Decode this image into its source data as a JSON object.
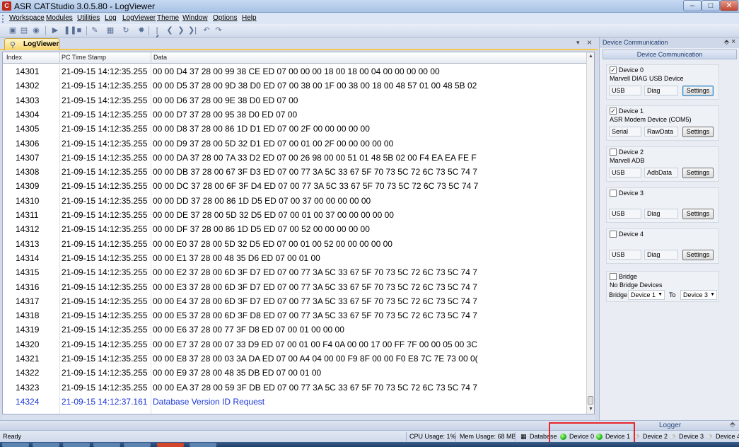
{
  "window": {
    "title": "ASR CATStudio 3.0.5.80 - LogViewer",
    "icon_glyph": "C"
  },
  "window_controls": {
    "minimize": "‒",
    "maximize": "□",
    "close": "✕"
  },
  "menu": [
    "Workspace",
    "Modules",
    "Utilities",
    "Log",
    "LogViewer",
    "Theme",
    "Window",
    "Options",
    "Help"
  ],
  "toolbar_icons": [
    "save-icon",
    "open-icon",
    "record-icon",
    "play-icon",
    "pause-icon",
    "stop-icon",
    "marker-icon",
    "filter-icon",
    "refresh-icon",
    "bulb-icon",
    "first-icon",
    "prev-icon",
    "next-icon",
    "last-icon",
    "undo-icon",
    "redo-icon"
  ],
  "toolbar_glyphs": [
    "▣",
    "▤",
    "◉",
    "▶",
    "❚❚",
    "■",
    "✎",
    "▦",
    "↻",
    "✹",
    "|❮",
    "❮",
    "❯",
    "❯|",
    "↶",
    "↷"
  ],
  "doc_tab": {
    "label": "LogViewer",
    "dropdown": "▾",
    "close": "×"
  },
  "grid": {
    "columns": [
      "Index",
      "PC Time Stamp",
      "Data"
    ],
    "rows": [
      {
        "index": "14301",
        "ts": "21-09-15 14:12:35.255",
        "data": "00 00 D4 37 28 00 99 38 CE ED 07 00 00 00 18 00 18 00 04 00 00 00 00 00"
      },
      {
        "index": "14302",
        "ts": "21-09-15 14:12:35.255",
        "data": "00 00 D5 37 28 00 9D 38 D0 ED 07 00 38 00 1F 00 38 00 18 00 48 57 01 00 48 5B 02"
      },
      {
        "index": "14303",
        "ts": "21-09-15 14:12:35.255",
        "data": "00 00 D6 37 28 00 9E 38 D0 ED 07 00"
      },
      {
        "index": "14304",
        "ts": "21-09-15 14:12:35.255",
        "data": "00 00 D7 37 28 00 95 38 D0 ED 07 00"
      },
      {
        "index": "14305",
        "ts": "21-09-15 14:12:35.255",
        "data": "00 00 D8 37 28 00 86 1D D1 ED 07 00 2F 00 00 00 00 00"
      },
      {
        "index": "14306",
        "ts": "21-09-15 14:12:35.255",
        "data": "00 00 D9 37 28 00 5D 32 D1 ED 07 00 01 00 2F 00 00 00 00 00"
      },
      {
        "index": "14307",
        "ts": "21-09-15 14:12:35.255",
        "data": "00 00 DA 37 28 00 7A 33 D2 ED 07 00 26 98 00 00 51 01 48 5B 02 00 F4 EA EA FE F"
      },
      {
        "index": "14308",
        "ts": "21-09-15 14:12:35.255",
        "data": "00 00 DB 37 28 00 67 3F D3 ED 07 00 77 3A 5C 33 67 5F 70 73 5C 72 6C 73 5C 74 7"
      },
      {
        "index": "14309",
        "ts": "21-09-15 14:12:35.255",
        "data": "00 00 DC 37 28 00 6F 3F D4 ED 07 00 77 3A 5C 33 67 5F 70 73 5C 72 6C 73 5C 74 7"
      },
      {
        "index": "14310",
        "ts": "21-09-15 14:12:35.255",
        "data": "00 00 DD 37 28 00 86 1D D5 ED 07 00 37 00 00 00 00 00"
      },
      {
        "index": "14311",
        "ts": "21-09-15 14:12:35.255",
        "data": "00 00 DE 37 28 00 5D 32 D5 ED 07 00 01 00 37 00 00 00 00 00"
      },
      {
        "index": "14312",
        "ts": "21-09-15 14:12:35.255",
        "data": "00 00 DF 37 28 00 86 1D D5 ED 07 00 52 00 00 00 00 00"
      },
      {
        "index": "14313",
        "ts": "21-09-15 14:12:35.255",
        "data": "00 00 E0 37 28 00 5D 32 D5 ED 07 00 01 00 52 00 00 00 00 00"
      },
      {
        "index": "14314",
        "ts": "21-09-15 14:12:35.255",
        "data": "00 00 E1 37 28 00 48 35 D6 ED 07 00 01 00"
      },
      {
        "index": "14315",
        "ts": "21-09-15 14:12:35.255",
        "data": "00 00 E2 37 28 00 6D 3F D7 ED 07 00 77 3A 5C 33 67 5F 70 73 5C 72 6C 73 5C 74 7"
      },
      {
        "index": "14316",
        "ts": "21-09-15 14:12:35.255",
        "data": "00 00 E3 37 28 00 6D 3F D7 ED 07 00 77 3A 5C 33 67 5F 70 73 5C 72 6C 73 5C 74 7"
      },
      {
        "index": "14317",
        "ts": "21-09-15 14:12:35.255",
        "data": "00 00 E4 37 28 00 6D 3F D7 ED 07 00 77 3A 5C 33 67 5F 70 73 5C 72 6C 73 5C 74 7"
      },
      {
        "index": "14318",
        "ts": "21-09-15 14:12:35.255",
        "data": "00 00 E5 37 28 00 6D 3F D8 ED 07 00 77 3A 5C 33 67 5F 70 73 5C 72 6C 73 5C 74 7"
      },
      {
        "index": "14319",
        "ts": "21-09-15 14:12:35.255",
        "data": "00 00 E6 37 28 00 77 3F D8 ED 07 00 01 00 00 00"
      },
      {
        "index": "14320",
        "ts": "21-09-15 14:12:35.255",
        "data": "00 00 E7 37 28 00 07 33 D9 ED 07 00 01 00 F4 0A 00 00 17 00 FF 7F 00 00 05 00 3C"
      },
      {
        "index": "14321",
        "ts": "21-09-15 14:12:35.255",
        "data": "00 00 E8 37 28 00 03 3A DA ED 07 00 A4 04 00 00 F9 8F 00 00 F0 E8 7C 7E 73 00 0("
      },
      {
        "index": "14322",
        "ts": "21-09-15 14:12:35.255",
        "data": "00 00 E9 37 28 00 48 35 DB ED 07 00 01 00"
      },
      {
        "index": "14323",
        "ts": "21-09-15 14:12:35.255",
        "data": "00 00 EA 37 28 00 59 3F DB ED 07 00 77 3A 5C 33 67 5F 70 73 5C 72 6C 73 5C 74 7"
      },
      {
        "index": "14324",
        "ts": "21-09-15 14:12:37.161",
        "data": "Database Version ID Request",
        "highlight": true
      }
    ]
  },
  "scroll": {
    "up": "▲",
    "down": "▼"
  },
  "panel": {
    "caption": "Device Communication",
    "pin": "⬘",
    "close": "×",
    "header": "Device Communication",
    "devices": [
      {
        "title": "Device 0",
        "checked": true,
        "description": "Marvell DIAG USB Device",
        "f1": "USB",
        "f2": "Diag",
        "button": "Settings",
        "focused": true
      },
      {
        "title": "Device 1",
        "checked": true,
        "description": "ASR Modem Device (COM5)",
        "f1": "Serial",
        "f2": "RawData",
        "button": "Settings"
      },
      {
        "title": "Device 2",
        "checked": false,
        "description": "Marvell ADB",
        "f1": "USB",
        "f2": "AdbData",
        "button": "Settings"
      },
      {
        "title": "Device 3",
        "checked": false,
        "description": "",
        "f1": "USB",
        "f2": "Diag",
        "button": "Settings"
      },
      {
        "title": "Device 4",
        "checked": false,
        "description": "",
        "f1": "USB",
        "f2": "Diag",
        "button": "Settings"
      }
    ],
    "bridge": {
      "title": "Bridge",
      "checked": false,
      "description": "No Bridge Devices",
      "from_label": "Bridge",
      "from_value": "Device 1",
      "to_label": "To",
      "to_value": "Device 3",
      "arrow": "▼"
    }
  },
  "logger": {
    "title": "Logger",
    "pin": "⬘"
  },
  "status": {
    "ready": "Ready",
    "cpu": "CPU Usage:  1%",
    "mem": "Mem Usage: 68 MB",
    "database": "Database",
    "devices": [
      {
        "label": "Device 0",
        "connected": true
      },
      {
        "label": "Device 1",
        "connected": true
      },
      {
        "label": "Device 2",
        "connected": false
      },
      {
        "label": "Device 3",
        "connected": false
      },
      {
        "label": "Device 4",
        "connected": false
      }
    ]
  },
  "colors": {
    "connected": "#21b814",
    "highlight_row": "#1a36d9",
    "annotation_box": "#e8232b"
  }
}
